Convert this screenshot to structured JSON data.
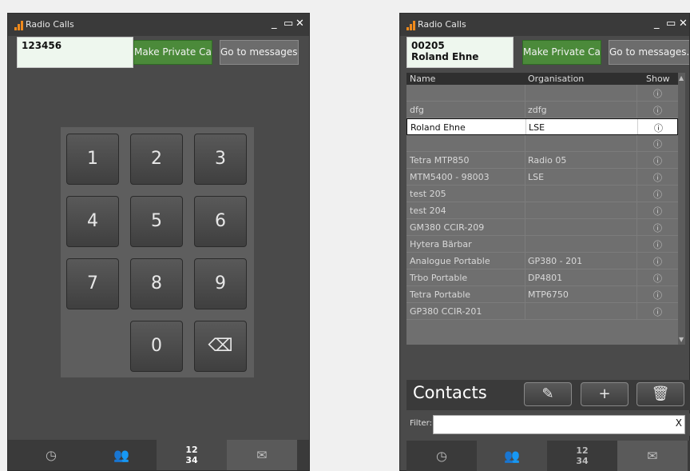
{
  "left_window": {
    "title": "Radio Calls",
    "number_display": "123456",
    "buttons": {
      "private_call": "Make Private Call",
      "messages": "Go to messages..."
    },
    "keys": [
      "1",
      "2",
      "3",
      "4",
      "5",
      "6",
      "7",
      "8",
      "9",
      "0"
    ]
  },
  "right_window": {
    "title": "Radio Calls",
    "display_line1": "00205",
    "display_line2": "Roland Ehne",
    "buttons": {
      "private_call": "Make Private Call",
      "messages": "Go to messages..."
    },
    "table": {
      "columns": [
        "Name",
        "Organisation",
        "Show"
      ],
      "rows": [
        {
          "name": "",
          "org": ""
        },
        {
          "name": "dfg",
          "org": "zdfg"
        },
        {
          "name": "Roland Ehne",
          "org": "LSE"
        },
        {
          "name": "",
          "org": ""
        },
        {
          "name": "Tetra MTP850",
          "org": "Radio 05"
        },
        {
          "name": "MTM5400 - 98003",
          "org": "LSE"
        },
        {
          "name": "test 205",
          "org": ""
        },
        {
          "name": "test 204",
          "org": ""
        },
        {
          "name": "GM380 CCIR-209",
          "org": ""
        },
        {
          "name": "Hytera Bärbar",
          "org": ""
        },
        {
          "name": "Analogue Portable",
          "org": "GP380 - 201"
        },
        {
          "name": "Trbo Portable",
          "org": "DP4801"
        },
        {
          "name": "Tetra Portable",
          "org": "MTP6750"
        },
        {
          "name": "GP380 CCIR-201",
          "org": ""
        }
      ],
      "selected_index": 2
    },
    "contacts_title": "Contacts",
    "filter_label": "Filter:",
    "filter_value": "",
    "filter_clear": "X"
  },
  "icons": {
    "clock": "clock-icon",
    "contacts": "people-icon",
    "keypad": "keypad-icon",
    "messages": "envelope-icon",
    "edit": "pencil-icon",
    "add": "plus-icon",
    "delete": "trash-icon",
    "show": "info-icon"
  },
  "colors": {
    "accent_green": "#4b8a3a",
    "signal_orange": "#f08a1c"
  }
}
